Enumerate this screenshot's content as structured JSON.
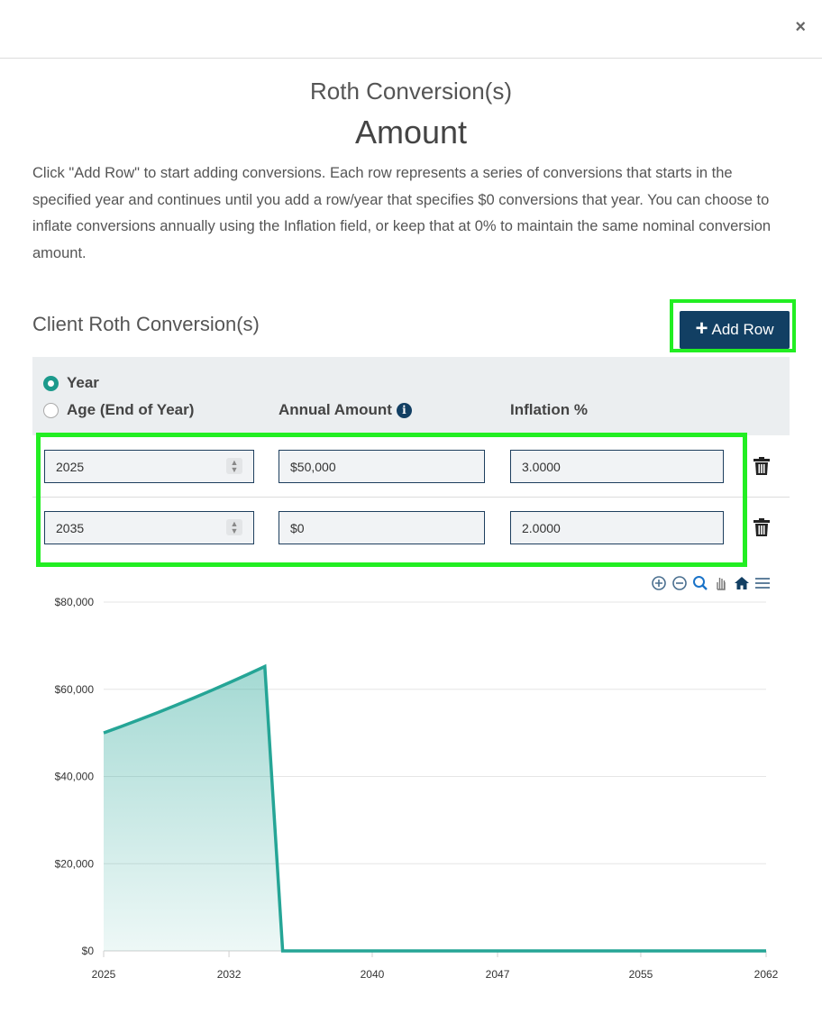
{
  "modal": {
    "close_label": "×",
    "subtitle": "Roth Conversion(s)",
    "title": "Amount",
    "description": "Click \"Add Row\" to start adding conversions. Each row represents a series of conversions that starts in the specified year and continues until you add a row/year that specifies $0 conversions that year. You can choose to inflate conversions annually using the Inflation field, or keep that at 0% to maintain the same nominal conversion amount."
  },
  "section": {
    "title": "Client Roth Conversion(s)",
    "add_row_label": "Add Row"
  },
  "table": {
    "radio_year_label": "Year",
    "radio_age_label": "Age (End of Year)",
    "selected_mode": "Year",
    "col_amount": "Annual Amount",
    "col_inflation": "Inflation %",
    "rows": [
      {
        "year": "2025",
        "amount": "$50,000",
        "inflation": "3.0000"
      },
      {
        "year": "2035",
        "amount": "$0",
        "inflation": "2.0000"
      }
    ]
  },
  "chart_data": {
    "type": "area",
    "title": "",
    "xlabel": "",
    "ylabel": "",
    "x_ticks": [
      "2025",
      "2032",
      "2040",
      "2047",
      "2055",
      "2062"
    ],
    "y_ticks": [
      "$0",
      "$20,000",
      "$40,000",
      "$60,000",
      "$80,000"
    ],
    "ylim": [
      0,
      80000
    ],
    "xlim": [
      2025,
      2062
    ],
    "series": [
      {
        "points": [
          [
            2025,
            50000
          ],
          [
            2026,
            51500
          ],
          [
            2027,
            53045
          ],
          [
            2028,
            54636
          ],
          [
            2029,
            56275
          ],
          [
            2030,
            57964
          ],
          [
            2031,
            59703
          ],
          [
            2032,
            61494
          ],
          [
            2033,
            63339
          ],
          [
            2034,
            65239
          ],
          [
            2035,
            0
          ],
          [
            2062,
            0
          ]
        ]
      }
    ],
    "color": "#25a596",
    "grid": true
  }
}
